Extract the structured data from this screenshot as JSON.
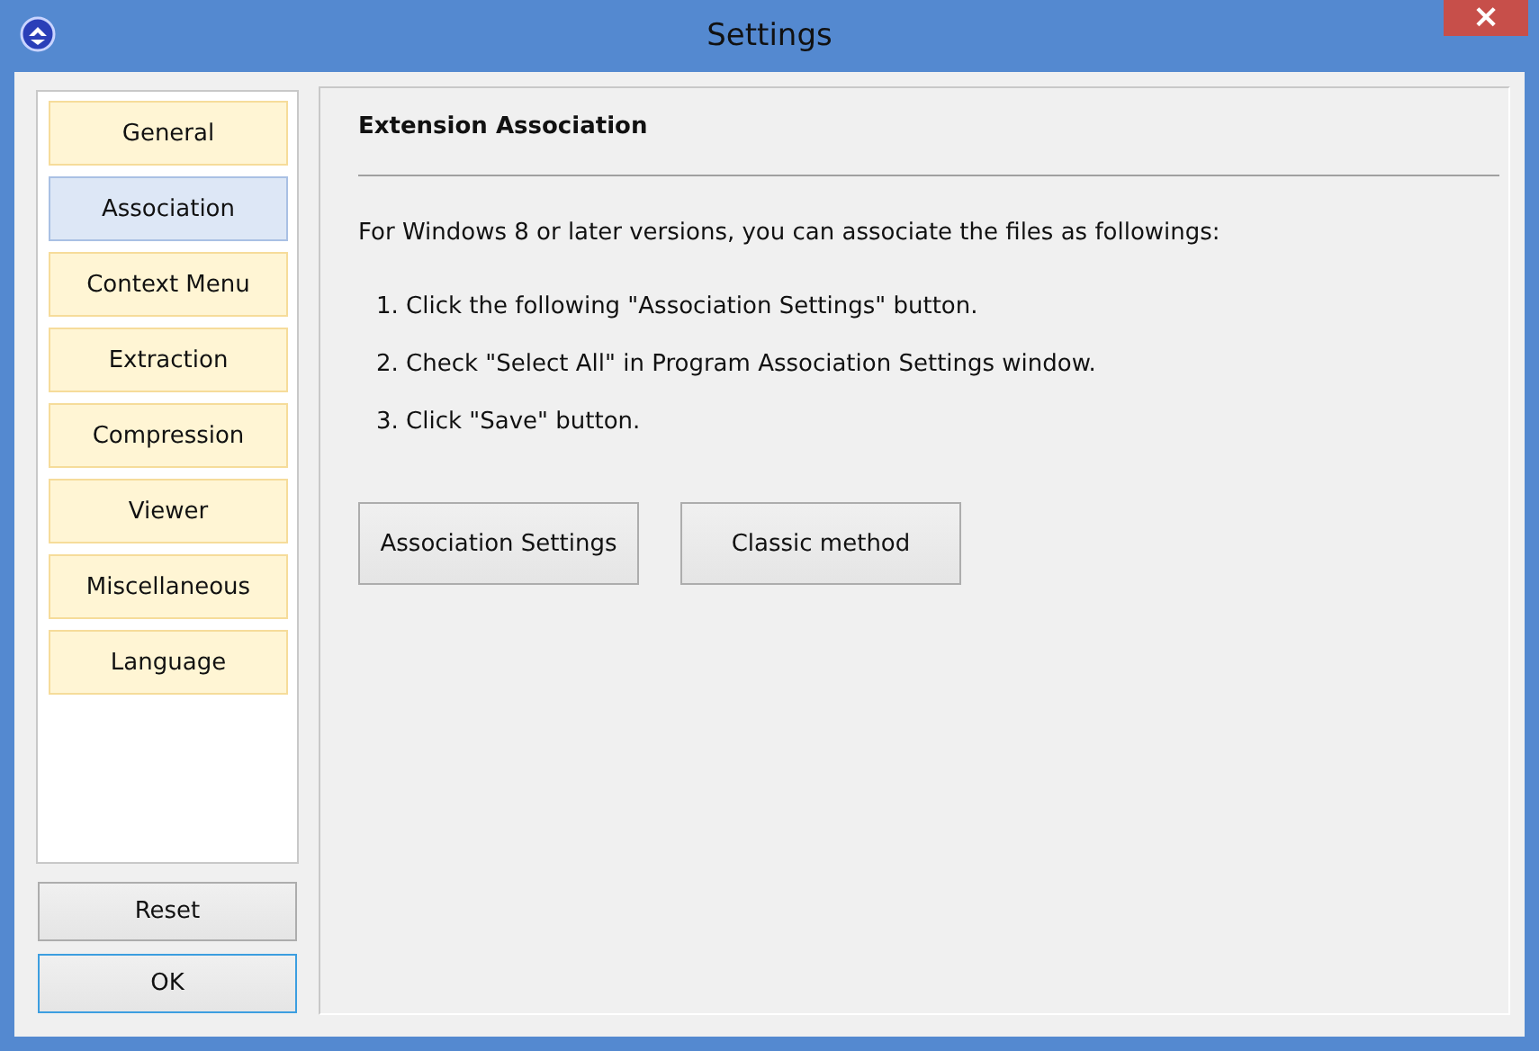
{
  "window": {
    "title": "Settings",
    "close": "×"
  },
  "sidebar": {
    "items": [
      {
        "label": "General",
        "selected": false
      },
      {
        "label": "Association",
        "selected": true
      },
      {
        "label": "Context Menu",
        "selected": false
      },
      {
        "label": "Extraction",
        "selected": false
      },
      {
        "label": "Compression",
        "selected": false
      },
      {
        "label": "Viewer",
        "selected": false
      },
      {
        "label": "Miscellaneous",
        "selected": false
      },
      {
        "label": "Language",
        "selected": false
      }
    ]
  },
  "footer_buttons": [
    {
      "label": "Reset",
      "default": false
    },
    {
      "label": "OK",
      "default": true
    }
  ],
  "content": {
    "heading": "Extension Association",
    "intro": "For Windows 8 or later versions, you can associate the files as followings:",
    "steps": [
      "1. Click the following \"Association Settings\" button.",
      "2. Check \"Select All\" in Program Association Settings window.",
      "3. Click \"Save\" button."
    ],
    "buttons": [
      "Association Settings",
      "Classic method"
    ]
  }
}
